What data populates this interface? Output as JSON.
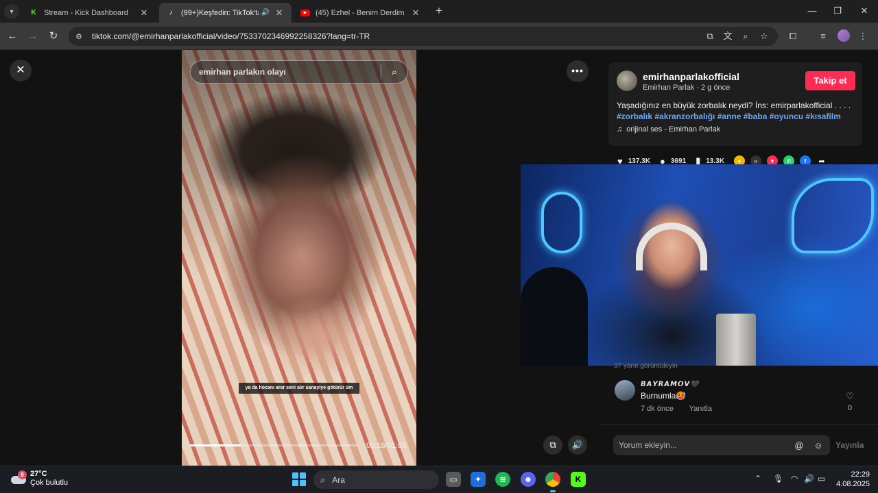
{
  "browser": {
    "tabs": [
      {
        "label": "Stream - Kick Dashboard",
        "favicon": "kick-icon",
        "active": false
      },
      {
        "label": "(99+)Keşfedin: TikTok'ta fav",
        "favicon": "tiktok-icon",
        "active": true
      },
      {
        "label": "(45) Ezhel - Benim Derdim (Live",
        "favicon": "youtube-icon",
        "active": false
      }
    ],
    "url": "tiktok.com/@emirhanparlakofficial/video/7533702346992258326?lang=tr-TR"
  },
  "page": {
    "search": {
      "query": "emirhan parlakın olayı"
    },
    "video": {
      "subtitle": "ya da hocanı arar seni alır sanayiye götürür üm",
      "time": "00:18/01:03",
      "progress": 0.3
    },
    "author": {
      "username": "emirhanparlakofficial",
      "display_name": "Emirhan Parlak",
      "age": "2 g önce",
      "follow_label": "Takip et",
      "description": "Yaşadığınız en büyük zorbalık neydi? İns: emirparlakofficial . . . .",
      "hashtags": "#zorbalık #akranzorbalığı #anne #baba #oyuncu #kısafilm",
      "sound": "orijinal ses - Emirhan Parlak"
    },
    "stats": {
      "likes": "137.3K",
      "comments": "3691",
      "saves": "13.3K"
    },
    "comments": {
      "partial_text": "37 yanıt görüntüleyin",
      "items": [
        {
          "user": "𝘽𝘼𝙔𝙍𝘼𝙈𝙊𝙑🖤",
          "text": "Burnumla🥵",
          "time": "7 dk önce",
          "reply_label": "Yanıtla",
          "likes": "0"
        }
      ]
    },
    "comment_input": {
      "placeholder": "Yorum ekleyin...",
      "post_label": "Yayınla"
    }
  },
  "taskbar": {
    "weather": {
      "temp": "27°C",
      "condition": "Çok bulutlu",
      "badge": "8"
    },
    "search_label": "Ara",
    "time": "22:29",
    "date": "4.08.2025"
  },
  "colors": {
    "accent": "#fe2c55",
    "hashtag": "#70a6f0",
    "taskbar_accent": "#4cc2ff"
  }
}
